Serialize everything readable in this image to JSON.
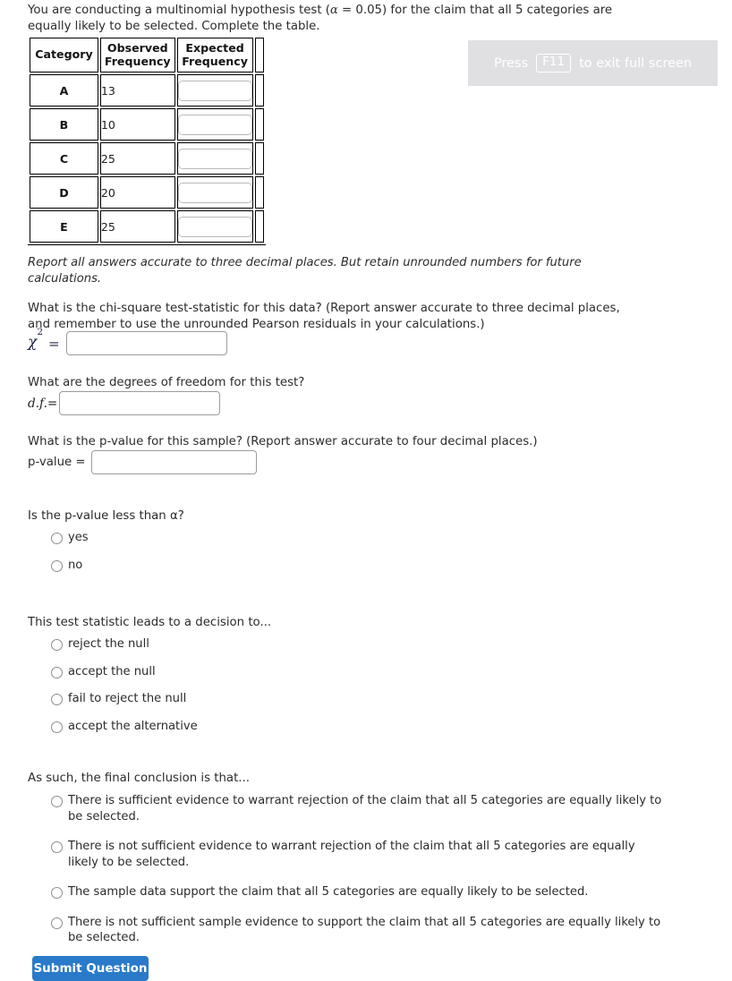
{
  "prompt": {
    "line1_a": "You are conducting a multinomial hypothesis test (",
    "alpha_symbol": "α",
    "line1_b": " = 0.05) for the claim that all 5 categories are equally likely to be selected. Complete the table."
  },
  "fullscreen_banner": {
    "press_label": "Press",
    "key_label": "F11",
    "exit_label": "to exit full screen",
    "background_color": "#e0e0e2",
    "text_color": "#ffffff"
  },
  "table": {
    "headers": [
      "Category",
      "Observed Frequency",
      "Expected Frequency"
    ],
    "header_cat": "Category",
    "header_obs_line1": "Observed",
    "header_obs_line2": "Frequency",
    "header_exp_line1": "Expected",
    "header_exp_line2": "Frequency",
    "rows": [
      {
        "category": "A",
        "observed": "13",
        "expected": ""
      },
      {
        "category": "B",
        "observed": "10",
        "expected": ""
      },
      {
        "category": "C",
        "observed": "25",
        "expected": ""
      },
      {
        "category": "D",
        "observed": "20",
        "expected": ""
      },
      {
        "category": "E",
        "observed": "25",
        "expected": ""
      }
    ]
  },
  "note": "Report all answers accurate to three decimal places. But retain unrounded numbers for future calculations.",
  "questions": {
    "chi_square": {
      "text": "What is the chi-square test-statistic for this data? (Report answer accurate to three decimal places, and remember to use the unrounded Pearson residuals in your calculations.)",
      "label_symbol": "χ",
      "label_exponent": "2",
      "label_equals": "=",
      "value": "",
      "placeholder": ""
    },
    "degrees_of_freedom": {
      "text": "What are the degrees of freedom for this test?",
      "label": "d.f.=",
      "value": "",
      "placeholder": ""
    },
    "p_value": {
      "text": "What is the p-value for this sample? (Report answer accurate to four decimal places.)",
      "label": "p-value =",
      "value": "",
      "placeholder": ""
    },
    "p_less_than_alpha": {
      "text": "Is the p-value less than α?",
      "options": [
        "yes",
        "no"
      ],
      "selected": null
    },
    "decision": {
      "text": "This test statistic leads to a decision to...",
      "options": [
        "reject the null",
        "accept the null",
        "fail to reject the null",
        "accept the alternative"
      ],
      "selected": null
    },
    "final_conclusion": {
      "text": "As such, the final conclusion is that...",
      "options": [
        "There is sufficient evidence to warrant rejection of the claim that all 5 categories are equally likely to be selected.",
        "There is not sufficient evidence to warrant rejection of the claim that all 5 categories are equally likely to be selected.",
        "The sample data support the claim that all 5 categories are equally likely to be selected.",
        "There is not sufficient sample evidence to support the claim that all 5 categories are equally likely to be selected."
      ],
      "selected": null
    }
  },
  "submit": {
    "label": "Submit Question",
    "color": "#2a7ac9"
  }
}
